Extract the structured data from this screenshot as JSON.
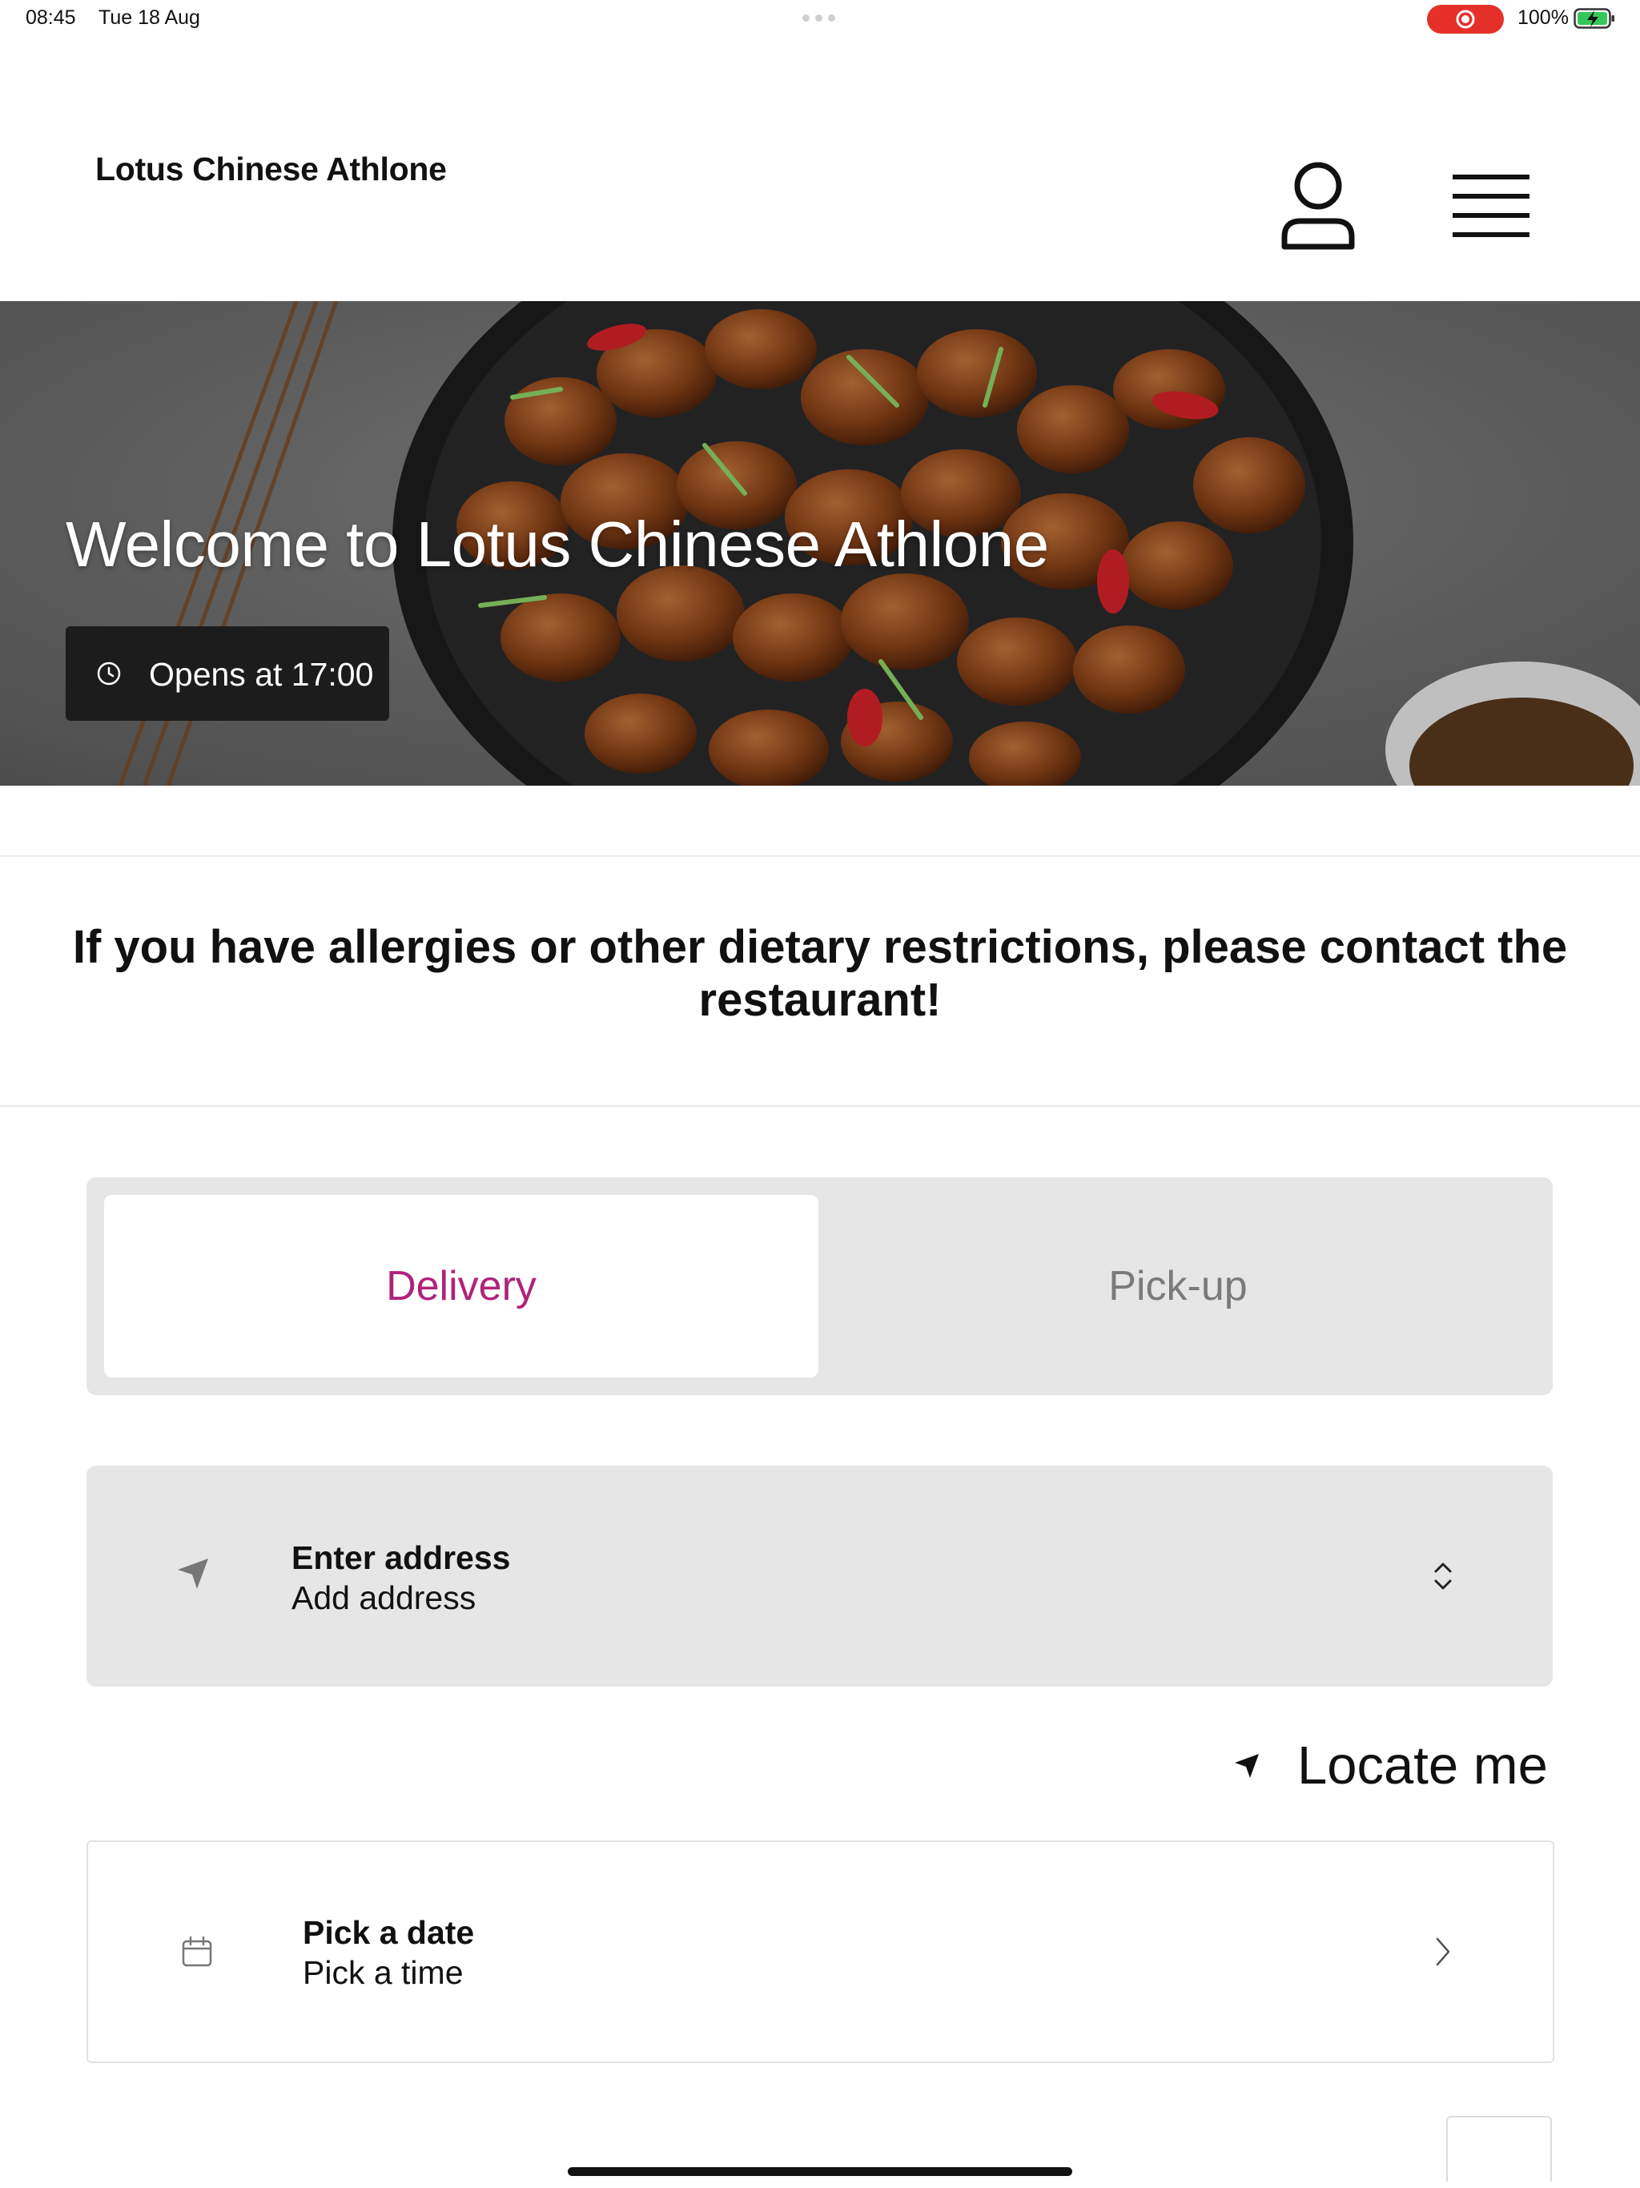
{
  "status_bar": {
    "time": "08:45",
    "date": "Tue 18 Aug",
    "battery_text": "100%",
    "recording_color": "#e5302a",
    "battery_color": "#34c759"
  },
  "header": {
    "restaurant_name": "Lotus Chinese Athlone",
    "account_icon": "person-icon",
    "menu_icon": "hamburger-menu-icon"
  },
  "hero": {
    "title": "Welcome to Lotus Chinese Athlone",
    "hours_text": "Opens at 17:00",
    "hours_icon": "clock-icon"
  },
  "notice": {
    "text": "If you have allergies or other dietary restrictions, please contact the restaurant!"
  },
  "order_mode": {
    "tabs": [
      {
        "label": "Delivery",
        "active": true
      },
      {
        "label": "Pick-up",
        "active": false
      }
    ],
    "accent_color": "#b0237a"
  },
  "address": {
    "title": "Enter address",
    "subtitle": "Add address",
    "icon": "location-arrow-icon"
  },
  "locate": {
    "label": "Locate me",
    "icon": "location-arrow-icon"
  },
  "schedule": {
    "title": "Pick a date",
    "subtitle": "Pick a time",
    "icon": "calendar-icon"
  }
}
